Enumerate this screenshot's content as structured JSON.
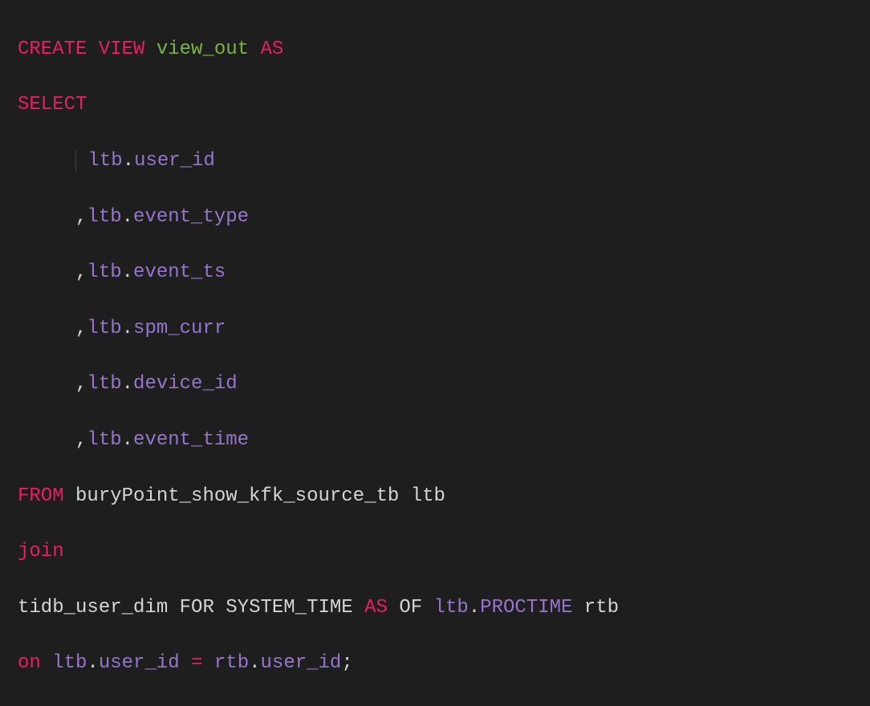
{
  "line1": {
    "create": "CREATE",
    "view": "VIEW",
    "name": "view_out",
    "as": "AS"
  },
  "line2": {
    "select": "SELECT"
  },
  "columns": {
    "c1": {
      "alias": "ltb",
      "col": "user_id"
    },
    "c2": {
      "comma": ",",
      "alias": "ltb",
      "col": "event_type"
    },
    "c3": {
      "comma": ",",
      "alias": "ltb",
      "col": "event_ts"
    },
    "c4": {
      "comma": ",",
      "alias": "ltb",
      "col": "spm_curr"
    },
    "c5": {
      "comma": ",",
      "alias": "ltb",
      "col": "device_id"
    },
    "c6": {
      "comma": ",",
      "alias": "ltb",
      "col": "event_time"
    }
  },
  "from": {
    "kw": "FROM",
    "table": "buryPoint_show_kfk_source_tb",
    "alias": "ltb"
  },
  "join": {
    "kw": "join"
  },
  "dim": {
    "table": "tidb_user_dim",
    "for": "FOR",
    "systime": "SYSTEM_TIME",
    "as": "AS",
    "of": "OF",
    "alias": "ltb",
    "proctime": "PROCTIME",
    "rtb": "rtb"
  },
  "on": {
    "kw": "on",
    "lalias": "ltb",
    "lcol": "user_id",
    "eq": "=",
    "ralias": "rtb",
    "rcol": "user_id",
    "semi": ";"
  }
}
